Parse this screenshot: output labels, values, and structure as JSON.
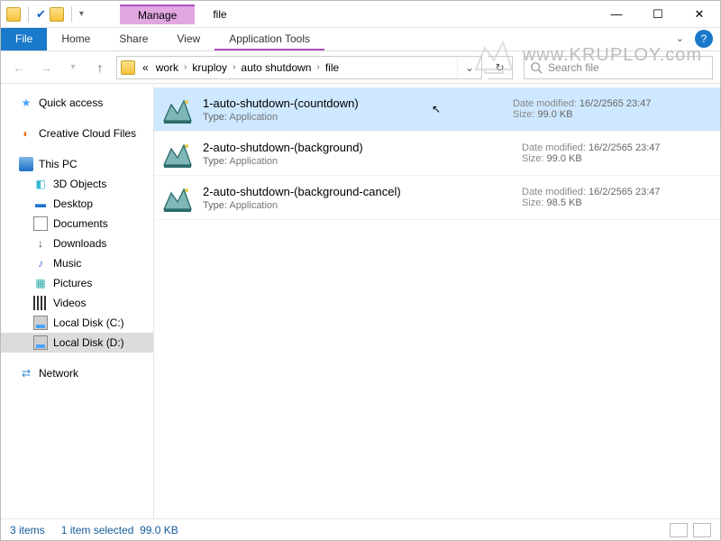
{
  "titlebar": {
    "context_tab": "Manage",
    "title": "file"
  },
  "ribbon": {
    "file": "File",
    "tabs": [
      "Home",
      "Share",
      "View"
    ],
    "context_tab": "Application Tools"
  },
  "nav": {
    "breadcrumbs_prefix": "«",
    "breadcrumbs": [
      "work",
      "kruploy",
      "auto shutdown",
      "file"
    ],
    "search_placeholder": "Search file"
  },
  "sidebar": {
    "quick": "Quick access",
    "creative": "Creative Cloud Files",
    "thispc": "This PC",
    "children": [
      {
        "label": "3D Objects"
      },
      {
        "label": "Desktop"
      },
      {
        "label": "Documents"
      },
      {
        "label": "Downloads"
      },
      {
        "label": "Music"
      },
      {
        "label": "Pictures"
      },
      {
        "label": "Videos"
      },
      {
        "label": "Local Disk (C:)"
      },
      {
        "label": "Local Disk (D:)"
      }
    ],
    "network": "Network"
  },
  "labels": {
    "type": "Type:",
    "date": "Date modified:",
    "size": "Size:"
  },
  "files": [
    {
      "name": "1-auto-shutdown-(countdown)",
      "type": "Application",
      "date": "16/2/2565 23:47",
      "size": "99.0 KB",
      "selected": true
    },
    {
      "name": "2-auto-shutdown-(background)",
      "type": "Application",
      "date": "16/2/2565 23:47",
      "size": "99.0 KB",
      "selected": false
    },
    {
      "name": "2-auto-shutdown-(background-cancel)",
      "type": "Application",
      "date": "16/2/2565 23:47",
      "size": "98.5 KB",
      "selected": false
    }
  ],
  "status": {
    "count": "3 items",
    "selection": "1 item selected",
    "size": "99.0 KB"
  },
  "watermark": "www.KRUPLOY.com"
}
